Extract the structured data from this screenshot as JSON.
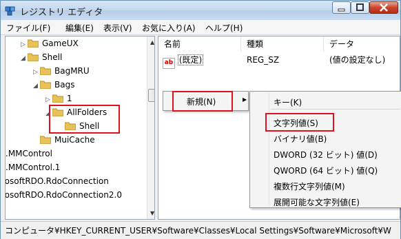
{
  "window": {
    "title": "レジストリ エディタ"
  },
  "menubar": {
    "items": [
      "ファイル(F)",
      "編集(E)",
      "表示(V)",
      "お気に入り(A)",
      "ヘルプ(H)"
    ]
  },
  "tree": {
    "items": [
      {
        "label": "GameUX"
      },
      {
        "label": "Shell"
      },
      {
        "label": "BagMRU"
      },
      {
        "label": "Bags"
      },
      {
        "label": "1"
      },
      {
        "label": "AllFolders"
      },
      {
        "label": "Shell"
      },
      {
        "label": "MuiCache"
      },
      {
        "label": ".MMControl"
      },
      {
        "label": ".MMControl.1"
      },
      {
        "label": "rosoftRDO.RdoConnection"
      },
      {
        "label": "rosoftRDO.RdoConnection2.0"
      }
    ]
  },
  "list": {
    "headers": [
      "名前",
      "種類",
      "データ"
    ],
    "rows": [
      {
        "name": "(既定)",
        "type": "REG_SZ",
        "data": "(値の設定なし)",
        "icon": "string-value-icon"
      }
    ]
  },
  "context_menu": {
    "item": "新規(N)"
  },
  "submenu": {
    "items": [
      "キー(K)",
      "文字列値(S)",
      "バイナリ値(B)",
      "DWORD (32 ビット) 値(D)",
      "QWORD (64 ビット) 値(Q)",
      "複数行文字列値(M)",
      "展開可能な文字列値(E)"
    ]
  },
  "statusbar": {
    "path": "コンピュータ¥HKEY_CURRENT_USER¥Software¥Classes¥Local Settings¥Software¥Microsoft¥W"
  },
  "colors": {
    "highlight_box": "#e0101e",
    "folder": "#e8c15a"
  }
}
